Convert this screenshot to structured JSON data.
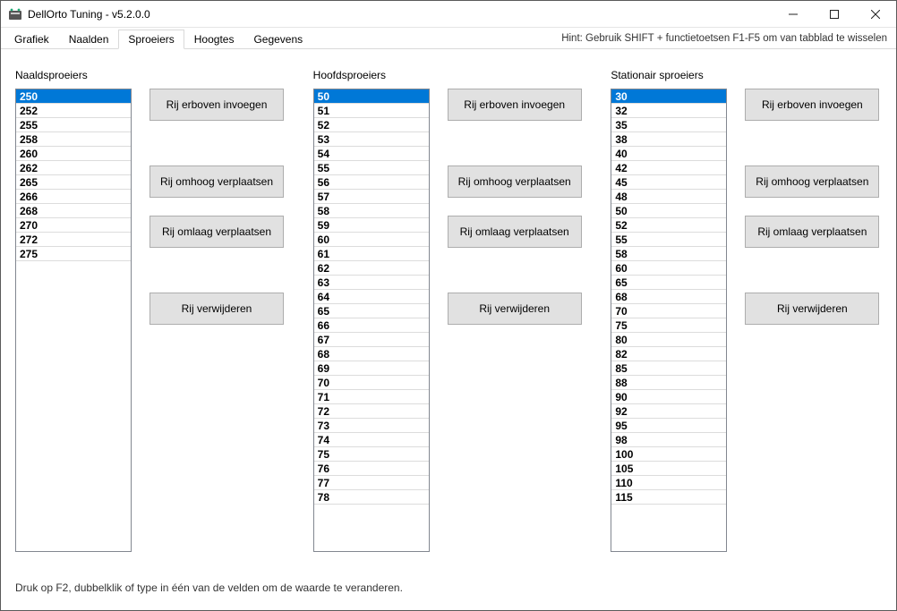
{
  "window": {
    "title": "DellOrto Tuning - v5.2.0.0"
  },
  "tabs": [
    {
      "label": "Grafiek",
      "active": false
    },
    {
      "label": "Naalden",
      "active": false
    },
    {
      "label": "Sproeiers",
      "active": true
    },
    {
      "label": "Hoogtes",
      "active": false
    },
    {
      "label": "Gegevens",
      "active": false
    }
  ],
  "hint": "Hint: Gebruik SHIFT + functietoetsen F1-F5 om van tabblad te wisselen",
  "columns": [
    {
      "id": "naaldsproeiers",
      "title": "Naaldsproeiers",
      "items": [
        "250",
        "252",
        "255",
        "258",
        "260",
        "262",
        "265",
        "266",
        "268",
        "270",
        "272",
        "275"
      ],
      "selectedIndex": 0
    },
    {
      "id": "hoofdsproeiers",
      "title": "Hoofdsproeiers",
      "items": [
        "50",
        "51",
        "52",
        "53",
        "54",
        "55",
        "56",
        "57",
        "58",
        "59",
        "60",
        "61",
        "62",
        "63",
        "64",
        "65",
        "66",
        "67",
        "68",
        "69",
        "70",
        "71",
        "72",
        "73",
        "74",
        "75",
        "76",
        "77",
        "78"
      ],
      "selectedIndex": 0
    },
    {
      "id": "stationair-sproeiers",
      "title": "Stationair sproeiers",
      "items": [
        "30",
        "32",
        "35",
        "38",
        "40",
        "42",
        "45",
        "48",
        "50",
        "52",
        "55",
        "58",
        "60",
        "65",
        "68",
        "70",
        "75",
        "80",
        "82",
        "85",
        "88",
        "90",
        "92",
        "95",
        "98",
        "100",
        "105",
        "110",
        "115"
      ],
      "selectedIndex": 0
    }
  ],
  "buttons": {
    "insertAbove": "Rij erboven invoegen",
    "moveUp": "Rij omhoog verplaatsen",
    "moveDown": "Rij omlaag verplaatsen",
    "delete": "Rij verwijderen"
  },
  "footer": "Druk op F2, dubbelklik of type in één van de velden om de waarde te veranderen."
}
